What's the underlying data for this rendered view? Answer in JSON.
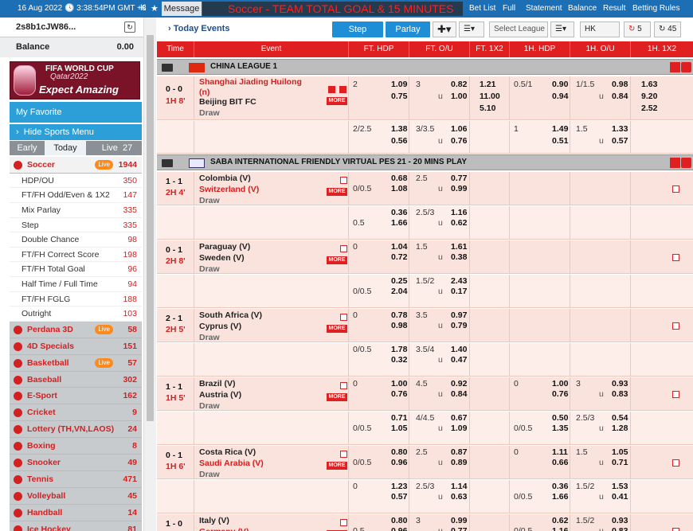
{
  "top": {
    "datetime": "16 Aug 2022 🕓 3:38:54PM GMT +8",
    "message_label": "Message",
    "ticker": "Soccer - TEAM TOTAL GOAL & 15 MINUTES",
    "links": [
      "Bet List",
      "Full",
      "Statement",
      "Balance",
      "Result",
      "Betting Rules"
    ]
  },
  "account": {
    "username": "2s8b1cJW86...",
    "balance_label": "Balance",
    "balance_value": "0.00"
  },
  "banner": {
    "line1": "FIFA WORLD CUP",
    "line2": "Qatar2022",
    "line3": "Expect Amazing"
  },
  "nav": {
    "favorite": "My Favorite",
    "hide_menu": "Hide Sports Menu",
    "tabs": [
      {
        "label": "Early"
      },
      {
        "label": "Today"
      },
      {
        "label": "Live",
        "count": "27"
      }
    ]
  },
  "menu": [
    {
      "label": "Soccer",
      "count": "1944",
      "live": "Live",
      "kind": "sport"
    },
    {
      "label": "HDP/OU",
      "count": "350",
      "kind": "sub"
    },
    {
      "label": "FT/FH Odd/Even & 1X2",
      "count": "147",
      "kind": "sub"
    },
    {
      "label": "Mix Parlay",
      "count": "335",
      "kind": "sub"
    },
    {
      "label": "Step",
      "count": "335",
      "kind": "sub"
    },
    {
      "label": "Double Chance",
      "count": "98",
      "kind": "sub"
    },
    {
      "label": "FT/FH Correct Score",
      "count": "198",
      "kind": "sub"
    },
    {
      "label": "FT/FH Total Goal",
      "count": "96",
      "kind": "sub"
    },
    {
      "label": "Half Time / Full Time",
      "count": "94",
      "kind": "sub"
    },
    {
      "label": "FT/FH FGLG",
      "count": "188",
      "kind": "sub"
    },
    {
      "label": "Outright",
      "count": "103",
      "kind": "sub"
    },
    {
      "label": "Perdana 3D",
      "count": "58",
      "live": "Live",
      "kind": "sport"
    },
    {
      "label": "4D Specials",
      "count": "151",
      "kind": "sport"
    },
    {
      "label": "Basketball",
      "count": "57",
      "live": "Live",
      "kind": "sport"
    },
    {
      "label": "Baseball",
      "count": "302",
      "kind": "sport"
    },
    {
      "label": "E-Sport",
      "count": "162",
      "kind": "sport"
    },
    {
      "label": "Cricket",
      "count": "9",
      "kind": "sport"
    },
    {
      "label": "Lottery (TH,VN,LAOS)",
      "count": "24",
      "kind": "sport"
    },
    {
      "label": "Boxing",
      "count": "8",
      "kind": "sport"
    },
    {
      "label": "Snooker",
      "count": "49",
      "kind": "sport"
    },
    {
      "label": "Tennis",
      "count": "471",
      "kind": "sport"
    },
    {
      "label": "Volleyball",
      "count": "45",
      "kind": "sport"
    },
    {
      "label": "Handball",
      "count": "14",
      "kind": "sport"
    },
    {
      "label": "Ice Hockey",
      "count": "81",
      "kind": "sport"
    }
  ],
  "header": {
    "title": "Today Events",
    "step": "Step",
    "parlay": "Parlay",
    "select_league": "Select League",
    "odds_type": "HK",
    "refresh_a": "5",
    "refresh_b": "45"
  },
  "columns": [
    "Time",
    "Event",
    "FT. HDP",
    "FT. O/U",
    "FT. 1X2",
    "1H. HDP",
    "1H. O/U",
    "1H. 1X2"
  ],
  "more_label": "MORE",
  "leagues": [
    {
      "name": "CHINA LEAGUE 1",
      "matches": [
        {
          "score": "0 - 0",
          "time": "1H 8'",
          "home": "Shanghai Jiading Huilong (n)",
          "away": "Beijing BIT FC",
          "draw": "Draw",
          "home_fav": true,
          "lines": [
            {
              "fh": "2",
              "fho": [
                "1.09",
                "0.75"
              ],
              "ou": "3",
              "ouo": [
                "0.82",
                "1.00"
              ],
              "x12": [
                "1.21",
                "11.00",
                "5.10"
              ],
              "h1": "0.5/1",
              "h1o": [
                "0.90",
                "0.94"
              ],
              "h1ou": "1/1.5",
              "h1ouo": [
                "0.98",
                "0.84"
              ],
              "h1x": [
                "1.63",
                "9.20",
                "2.52"
              ]
            },
            {
              "fh": "2/2.5",
              "fho": [
                "1.38",
                "0.56"
              ],
              "ou": "3/3.5",
              "ouo": [
                "1.06",
                "0.76"
              ],
              "x12": [],
              "h1": "1",
              "h1o": [
                "1.49",
                "0.51"
              ],
              "h1ou": "1.5",
              "h1ouo": [
                "1.33",
                "0.57"
              ],
              "h1x": []
            }
          ]
        }
      ]
    },
    {
      "name": "SABA INTERNATIONAL FRIENDLY VIRTUAL PES 21 - 20 MINS PLAY",
      "matches": [
        {
          "score": "1 - 1",
          "time": "2H 4'",
          "home": "Colombia (V)",
          "away": "Switzerland (V)",
          "draw": "Draw",
          "away_fav": true,
          "lines": [
            {
              "fh": "0/0.5",
              "fhrow": 2,
              "fho": [
                "0.68",
                "1.08"
              ],
              "ou": "2.5",
              "ouo": [
                "0.77",
                "0.99"
              ]
            },
            {
              "fh": "0.5",
              "fhrow": 2,
              "fho": [
                "0.36",
                "1.66"
              ],
              "ou": "2.5/3",
              "ouo": [
                "1.16",
                "0.62"
              ]
            }
          ]
        },
        {
          "score": "0 - 1",
          "time": "2H 8'",
          "home": "Paraguay (V)",
          "away": "Sweden (V)",
          "draw": "Draw",
          "lines": [
            {
              "fh": "0",
              "fhrow": 1,
              "fho": [
                "1.04",
                "0.72"
              ],
              "ou": "1.5",
              "ouo": [
                "1.61",
                "0.38"
              ]
            },
            {
              "fh": "0/0.5",
              "fhrow": 2,
              "fho": [
                "0.25",
                "2.04"
              ],
              "ou": "1.5/2",
              "ouo": [
                "2.43",
                "0.17"
              ]
            }
          ]
        },
        {
          "score": "2 - 1",
          "time": "2H 5'",
          "home": "South Africa (V)",
          "away": "Cyprus (V)",
          "draw": "Draw",
          "lines": [
            {
              "fh": "0",
              "fhrow": 1,
              "fho": [
                "0.78",
                "0.98"
              ],
              "ou": "3.5",
              "ouo": [
                "0.97",
                "0.79"
              ]
            },
            {
              "fh": "0/0.5",
              "fhrow": 1,
              "fho": [
                "1.78",
                "0.32"
              ],
              "ou": "3.5/4",
              "ouo": [
                "1.40",
                "0.47"
              ]
            }
          ]
        },
        {
          "score": "1 - 1",
          "time": "1H 5'",
          "home": "Brazil (V)",
          "away": "Austria (V)",
          "draw": "Draw",
          "lines": [
            {
              "fh": "0",
              "fhrow": 1,
              "fho": [
                "1.00",
                "0.76"
              ],
              "ou": "4.5",
              "ouo": [
                "0.92",
                "0.84"
              ],
              "h1": "0",
              "h1row": 1,
              "h1o": [
                "1.00",
                "0.76"
              ],
              "h1ou": "3",
              "h1ouo": [
                "0.93",
                "0.83"
              ]
            },
            {
              "fh": "0/0.5",
              "fhrow": 2,
              "fho": [
                "0.71",
                "1.05"
              ],
              "ou": "4/4.5",
              "ouo": [
                "0.67",
                "1.09"
              ],
              "h1": "0/0.5",
              "h1row": 2,
              "h1o": [
                "0.50",
                "1.35"
              ],
              "h1ou": "2.5/3",
              "h1ouo": [
                "0.54",
                "1.28"
              ]
            }
          ]
        },
        {
          "score": "0 - 1",
          "time": "1H 6'",
          "home": "Costa Rica (V)",
          "away": "Saudi Arabia (V)",
          "draw": "Draw",
          "away_fav": true,
          "lines": [
            {
              "fh": "0/0.5",
              "fhrow": 2,
              "fho": [
                "0.80",
                "0.96"
              ],
              "ou": "2.5",
              "ouo": [
                "0.87",
                "0.89"
              ],
              "h1": "0",
              "h1row": 1,
              "h1o": [
                "1.11",
                "0.66"
              ],
              "h1ou": "1.5",
              "h1ouo": [
                "1.05",
                "0.71"
              ]
            },
            {
              "fh": "0",
              "fhrow": 1,
              "fho": [
                "1.23",
                "0.57"
              ],
              "ou": "2.5/3",
              "ouo": [
                "1.14",
                "0.63"
              ],
              "h1": "0/0.5",
              "h1row": 2,
              "h1o": [
                "0.36",
                "1.66"
              ],
              "h1ou": "1.5/2",
              "h1ouo": [
                "1.53",
                "0.41"
              ]
            }
          ]
        },
        {
          "score": "1 - 0",
          "time": "1H 6'",
          "home": "Italy (V)",
          "away": "Germany (V)",
          "draw": "Draw",
          "away_fav": true,
          "lines": [
            {
              "fh": "0.5",
              "fhrow": 2,
              "fho": [
                "0.80",
                "0.96"
              ],
              "ou": "3",
              "ouo": [
                "0.99",
                "0.77"
              ],
              "h1": "0/0.5",
              "h1row": 2,
              "h1o": [
                "0.62",
                "1.16"
              ],
              "h1ou": "1.5/2",
              "h1ouo": [
                "0.93",
                "0.83"
              ]
            }
          ]
        }
      ]
    }
  ]
}
